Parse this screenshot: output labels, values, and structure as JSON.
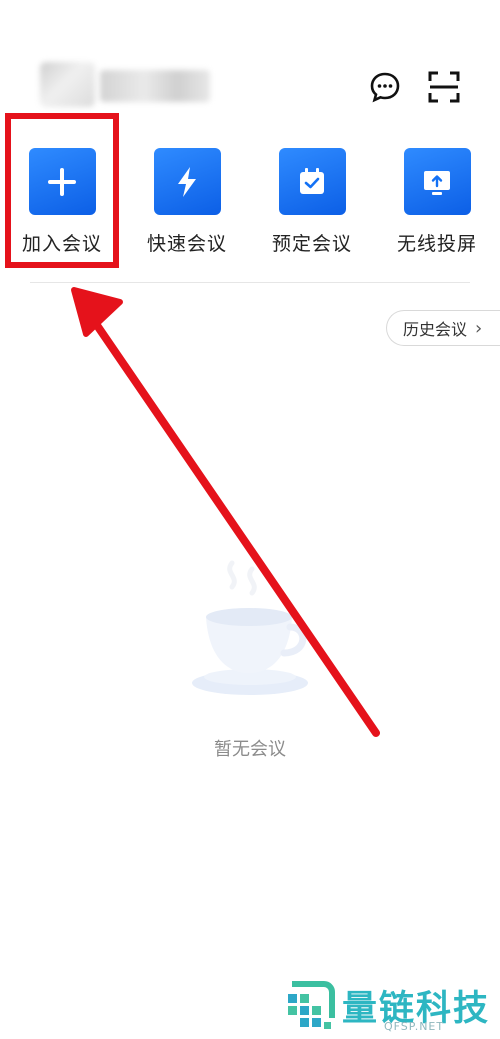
{
  "header": {
    "icons": [
      "message-icon",
      "scan-icon"
    ]
  },
  "actions": [
    {
      "label": "加入会议",
      "icon": "plus-icon"
    },
    {
      "label": "快速会议",
      "icon": "lightning-icon"
    },
    {
      "label": "预定会议",
      "icon": "calendar-check-icon"
    },
    {
      "label": "无线投屏",
      "icon": "screen-cast-icon"
    }
  ],
  "history_button": {
    "label": "历史会议",
    "chevron": "›"
  },
  "empty_state": {
    "text": "暂无会议",
    "illustration": "coffee-cup-icon"
  },
  "annotation": {
    "highlight_color": "#e5121b"
  },
  "watermark": {
    "brand": "量链科技",
    "domain": "QFSP.NET"
  },
  "colors": {
    "accent": "#1371f5",
    "watermark": "#2db6c2"
  }
}
